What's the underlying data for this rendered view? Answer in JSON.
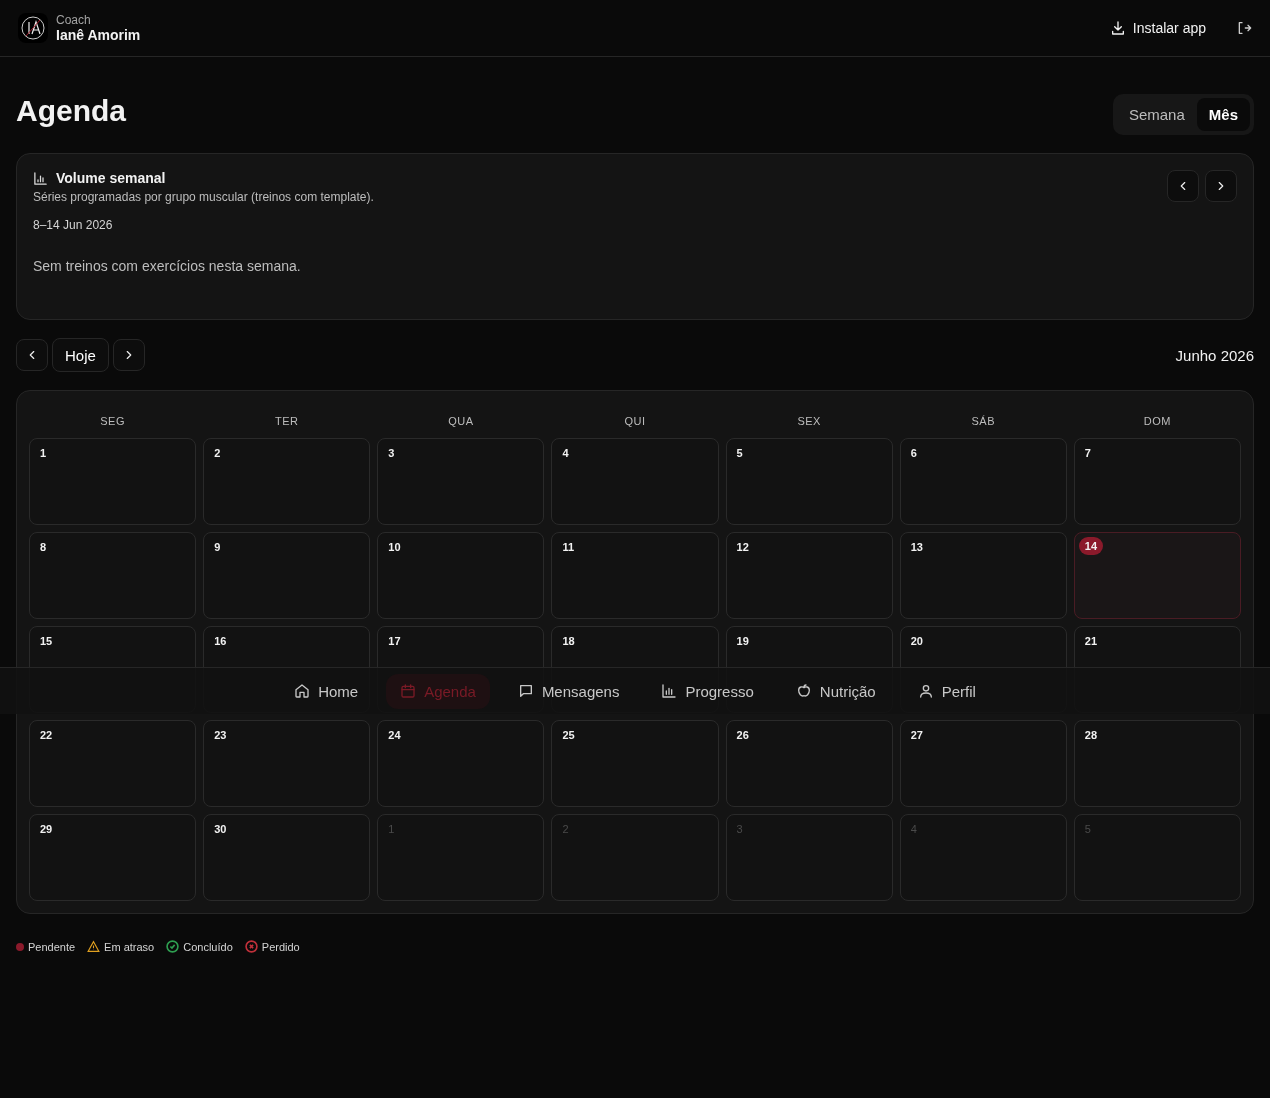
{
  "header": {
    "role": "Coach",
    "name": "Ianê Amorim",
    "install": "Instalar app"
  },
  "page": {
    "title": "Agenda",
    "views": [
      {
        "label": "Semana",
        "selected": false
      },
      {
        "label": "Mês",
        "selected": true
      }
    ]
  },
  "volume": {
    "title": "Volume semanal",
    "subtitle": "Séries programadas por grupo muscular (treinos com template).",
    "range": "8–14 Jun 2026",
    "empty": "Sem treinos com exercícios nesta semana."
  },
  "calendar": {
    "today_button": "Hoje",
    "month": "Junho 2026",
    "weekdays": [
      "SEG",
      "TER",
      "QUA",
      "QUI",
      "SEX",
      "SÁB",
      "DOM"
    ],
    "days": [
      {
        "label": "1",
        "outside": false,
        "today": false
      },
      {
        "label": "2",
        "outside": false,
        "today": false
      },
      {
        "label": "3",
        "outside": false,
        "today": false
      },
      {
        "label": "4",
        "outside": false,
        "today": false
      },
      {
        "label": "5",
        "outside": false,
        "today": false
      },
      {
        "label": "6",
        "outside": false,
        "today": false
      },
      {
        "label": "7",
        "outside": false,
        "today": false
      },
      {
        "label": "8",
        "outside": false,
        "today": false
      },
      {
        "label": "9",
        "outside": false,
        "today": false
      },
      {
        "label": "10",
        "outside": false,
        "today": false
      },
      {
        "label": "11",
        "outside": false,
        "today": false
      },
      {
        "label": "12",
        "outside": false,
        "today": false
      },
      {
        "label": "13",
        "outside": false,
        "today": false
      },
      {
        "label": "14",
        "outside": false,
        "today": true
      },
      {
        "label": "15",
        "outside": false,
        "today": false
      },
      {
        "label": "16",
        "outside": false,
        "today": false
      },
      {
        "label": "17",
        "outside": false,
        "today": false
      },
      {
        "label": "18",
        "outside": false,
        "today": false
      },
      {
        "label": "19",
        "outside": false,
        "today": false
      },
      {
        "label": "20",
        "outside": false,
        "today": false
      },
      {
        "label": "21",
        "outside": false,
        "today": false
      },
      {
        "label": "22",
        "outside": false,
        "today": false
      },
      {
        "label": "23",
        "outside": false,
        "today": false
      },
      {
        "label": "24",
        "outside": false,
        "today": false
      },
      {
        "label": "25",
        "outside": false,
        "today": false
      },
      {
        "label": "26",
        "outside": false,
        "today": false
      },
      {
        "label": "27",
        "outside": false,
        "today": false
      },
      {
        "label": "28",
        "outside": false,
        "today": false
      },
      {
        "label": "29",
        "outside": false,
        "today": false
      },
      {
        "label": "30",
        "outside": false,
        "today": false
      },
      {
        "label": "1",
        "outside": true,
        "today": false
      },
      {
        "label": "2",
        "outside": true,
        "today": false
      },
      {
        "label": "3",
        "outside": true,
        "today": false
      },
      {
        "label": "4",
        "outside": true,
        "today": false
      },
      {
        "label": "5",
        "outside": true,
        "today": false
      }
    ]
  },
  "legend": [
    {
      "kind": "dot",
      "label": "Pendente",
      "color": "#8b1a2b"
    },
    {
      "kind": "warning",
      "label": "Em atraso",
      "color": "#e0a020"
    },
    {
      "kind": "check",
      "label": "Concluído",
      "color": "#2e9e50"
    },
    {
      "kind": "cross",
      "label": "Perdido",
      "color": "#c0303a"
    }
  ],
  "nav": [
    {
      "kind": "home",
      "label": "Home",
      "selected": false
    },
    {
      "kind": "calendar",
      "label": "Agenda",
      "selected": true
    },
    {
      "kind": "chat",
      "label": "Mensagens",
      "selected": false
    },
    {
      "kind": "chart",
      "label": "Progresso",
      "selected": false
    },
    {
      "kind": "apple",
      "label": "Nutrição",
      "selected": false
    },
    {
      "kind": "user",
      "label": "Perfil",
      "selected": false
    }
  ]
}
